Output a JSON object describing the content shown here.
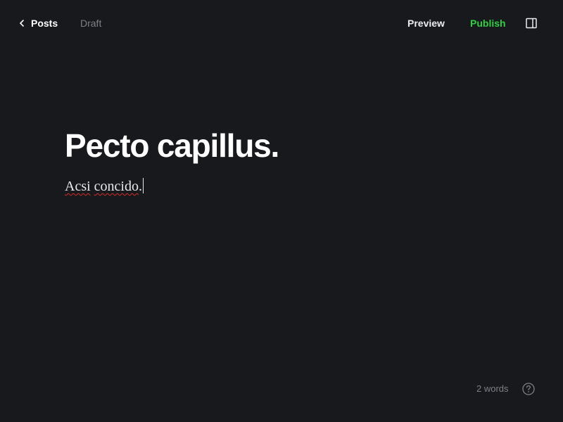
{
  "header": {
    "back_label": "Posts",
    "status": "Draft",
    "preview_label": "Preview",
    "publish_label": "Publish",
    "back_icon": "chevron-left-icon",
    "sidebar_icon": "sidebar-toggle-icon"
  },
  "editor": {
    "title": "Pecto capillus.",
    "body_word1": "Acsi",
    "body_word2": "concido",
    "body_punct": "."
  },
  "footer": {
    "word_count": "2 words",
    "help_icon": "help-circle-icon"
  },
  "colors": {
    "background": "#18191d",
    "publish": "#30cf43",
    "muted": "#7d8087",
    "spellcheck": "#d62b2b"
  }
}
